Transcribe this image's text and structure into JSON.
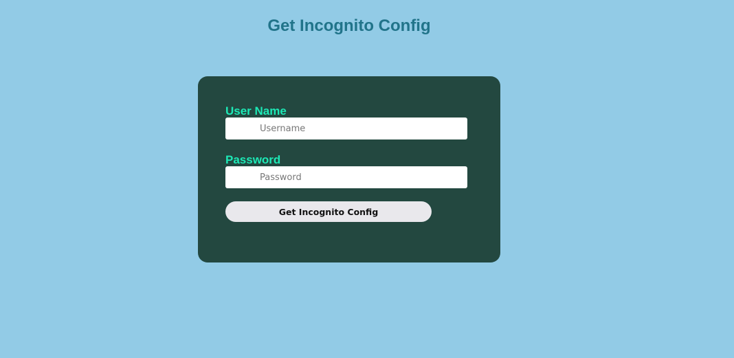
{
  "page": {
    "title": "Get Incognito Config"
  },
  "form": {
    "username_label": "User Name",
    "username_placeholder": "Username",
    "username_value": "",
    "password_label": "Password",
    "password_placeholder": "Password",
    "password_value": "",
    "submit_label": "Get Incognito Config"
  },
  "colors": {
    "background": "#92cbe6",
    "title": "#21748a",
    "card": "#234840",
    "label": "#1de9b6",
    "button": "#e9e8ec"
  }
}
